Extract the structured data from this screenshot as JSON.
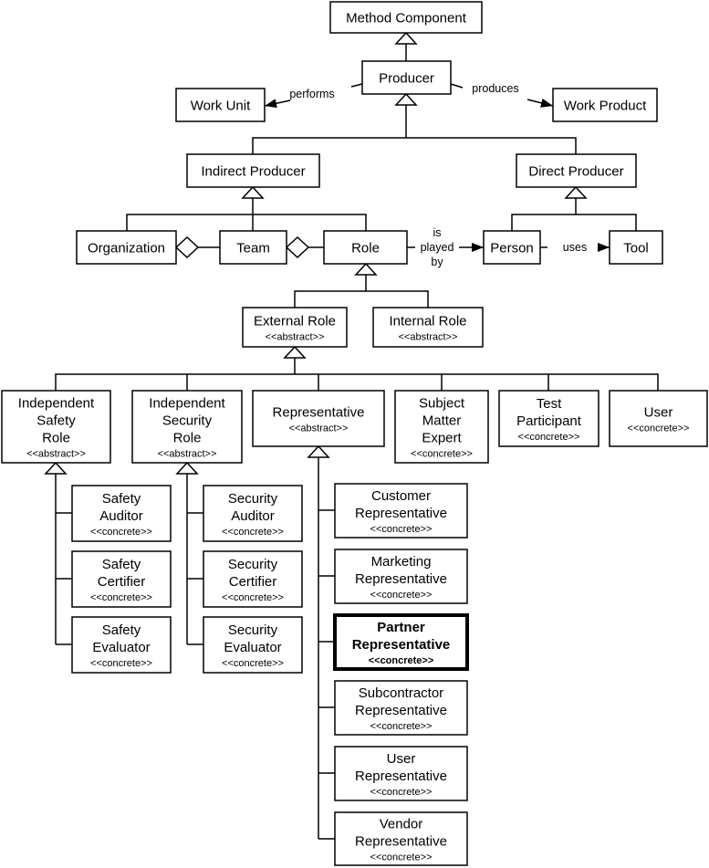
{
  "nodes": {
    "method_component": {
      "lines": [
        "Method Component"
      ],
      "stereo": ""
    },
    "producer": {
      "lines": [
        "Producer"
      ],
      "stereo": ""
    },
    "work_unit": {
      "lines": [
        "Work Unit"
      ],
      "stereo": ""
    },
    "work_product": {
      "lines": [
        "Work Product"
      ],
      "stereo": ""
    },
    "indirect_producer": {
      "lines": [
        "Indirect Producer"
      ],
      "stereo": ""
    },
    "direct_producer": {
      "lines": [
        "Direct Producer"
      ],
      "stereo": ""
    },
    "organization": {
      "lines": [
        "Organization"
      ],
      "stereo": ""
    },
    "team": {
      "lines": [
        "Team"
      ],
      "stereo": ""
    },
    "role": {
      "lines": [
        "Role"
      ],
      "stereo": ""
    },
    "person": {
      "lines": [
        "Person"
      ],
      "stereo": ""
    },
    "tool": {
      "lines": [
        "Tool"
      ],
      "stereo": ""
    },
    "external_role": {
      "lines": [
        "External Role"
      ],
      "stereo": "<<abstract>>"
    },
    "internal_role": {
      "lines": [
        "Internal Role"
      ],
      "stereo": "<<abstract>>"
    },
    "independent_safety_role": {
      "lines": [
        "Independent",
        "Safety",
        "Role"
      ],
      "stereo": "<<abstract>>"
    },
    "independent_security_role": {
      "lines": [
        "Independent",
        "Security",
        "Role"
      ],
      "stereo": "<<abstract>>"
    },
    "representative": {
      "lines": [
        "Representative"
      ],
      "stereo": "<<abstract>>"
    },
    "subject_matter_expert": {
      "lines": [
        "Subject",
        "Matter",
        "Expert"
      ],
      "stereo": "<<concrete>>"
    },
    "test_participant": {
      "lines": [
        "Test",
        "Participant"
      ],
      "stereo": "<<concrete>>"
    },
    "user": {
      "lines": [
        "User"
      ],
      "stereo": "<<concrete>>"
    },
    "safety_auditor": {
      "lines": [
        "Safety",
        "Auditor"
      ],
      "stereo": "<<concrete>>"
    },
    "safety_certifier": {
      "lines": [
        "Safety",
        "Certifier"
      ],
      "stereo": "<<concrete>>"
    },
    "safety_evaluator": {
      "lines": [
        "Safety",
        "Evaluator"
      ],
      "stereo": "<<concrete>>"
    },
    "security_auditor": {
      "lines": [
        "Security",
        "Auditor"
      ],
      "stereo": "<<concrete>>"
    },
    "security_certifier": {
      "lines": [
        "Security",
        "Certifier"
      ],
      "stereo": "<<concrete>>"
    },
    "security_evaluator": {
      "lines": [
        "Security",
        "Evaluator"
      ],
      "stereo": "<<concrete>>"
    },
    "customer_representative": {
      "lines": [
        "Customer",
        "Representative"
      ],
      "stereo": "<<concrete>>"
    },
    "marketing_representative": {
      "lines": [
        "Marketing",
        "Representative"
      ],
      "stereo": "<<concrete>>"
    },
    "partner_representative": {
      "lines": [
        "Partner",
        "Representative"
      ],
      "stereo": "<<concrete>>",
      "highlighted": true
    },
    "subcontractor_representative": {
      "lines": [
        "Subcontractor",
        "Representative"
      ],
      "stereo": "<<concrete>>"
    },
    "user_representative": {
      "lines": [
        "User",
        "Representative"
      ],
      "stereo": "<<concrete>>"
    },
    "vendor_representative": {
      "lines": [
        "Vendor",
        "Representative"
      ],
      "stereo": "<<concrete>>"
    }
  },
  "edge_labels": {
    "performs": "performs",
    "produces": "produces",
    "is_played_by": [
      "is",
      "played",
      "by"
    ],
    "uses": "uses"
  }
}
